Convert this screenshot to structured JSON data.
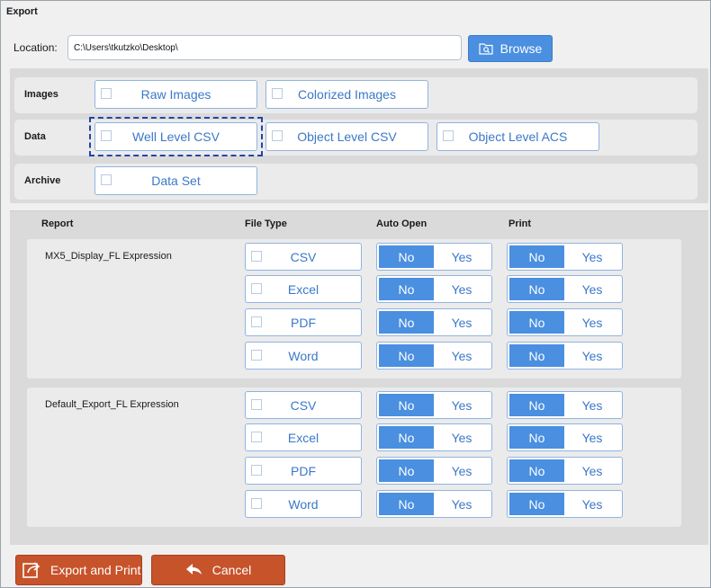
{
  "window": {
    "title": "Export"
  },
  "location": {
    "label": "Location:",
    "value": "C:\\Users\\tkutzko\\Desktop\\",
    "browse_label": "Browse"
  },
  "categories": {
    "images": {
      "label": "Images",
      "options": [
        "Raw Images",
        "Colorized Images"
      ]
    },
    "data": {
      "label": "Data",
      "options": [
        "Well Level CSV",
        "Object Level CSV",
        "Object Level ACS"
      ],
      "focused": "Well Level CSV"
    },
    "archive": {
      "label": "Archive",
      "options": [
        "Data Set"
      ]
    }
  },
  "report_table": {
    "headers": {
      "report": "Report",
      "file_type": "File Type",
      "auto_open": "Auto Open",
      "print": "Print"
    },
    "toggle_labels": {
      "no": "No",
      "yes": "Yes"
    },
    "groups": [
      {
        "name": "MX5_Display_FL Expression",
        "rows": [
          {
            "file_type": "CSV",
            "auto_open": "No",
            "print": "No"
          },
          {
            "file_type": "Excel",
            "auto_open": "No",
            "print": "No"
          },
          {
            "file_type": "PDF",
            "auto_open": "No",
            "print": "No"
          },
          {
            "file_type": "Word",
            "auto_open": "No",
            "print": "No"
          }
        ]
      },
      {
        "name": "Default_Export_FL Expression",
        "rows": [
          {
            "file_type": "CSV",
            "auto_open": "No",
            "print": "No"
          },
          {
            "file_type": "Excel",
            "auto_open": "No",
            "print": "No"
          },
          {
            "file_type": "PDF",
            "auto_open": "No",
            "print": "No"
          },
          {
            "file_type": "Word",
            "auto_open": "No",
            "print": "No"
          }
        ]
      }
    ]
  },
  "footer": {
    "export_label": "Export and Print",
    "cancel_label": "Cancel"
  },
  "colors": {
    "accent": "#4a8fe0",
    "option_text": "#3b78c9",
    "footer_button": "#c7532b",
    "focus_ring": "#2244aa"
  },
  "icons": {
    "browse": "folder-search-icon",
    "export": "export-share-icon",
    "cancel": "back-arrow-icon"
  }
}
